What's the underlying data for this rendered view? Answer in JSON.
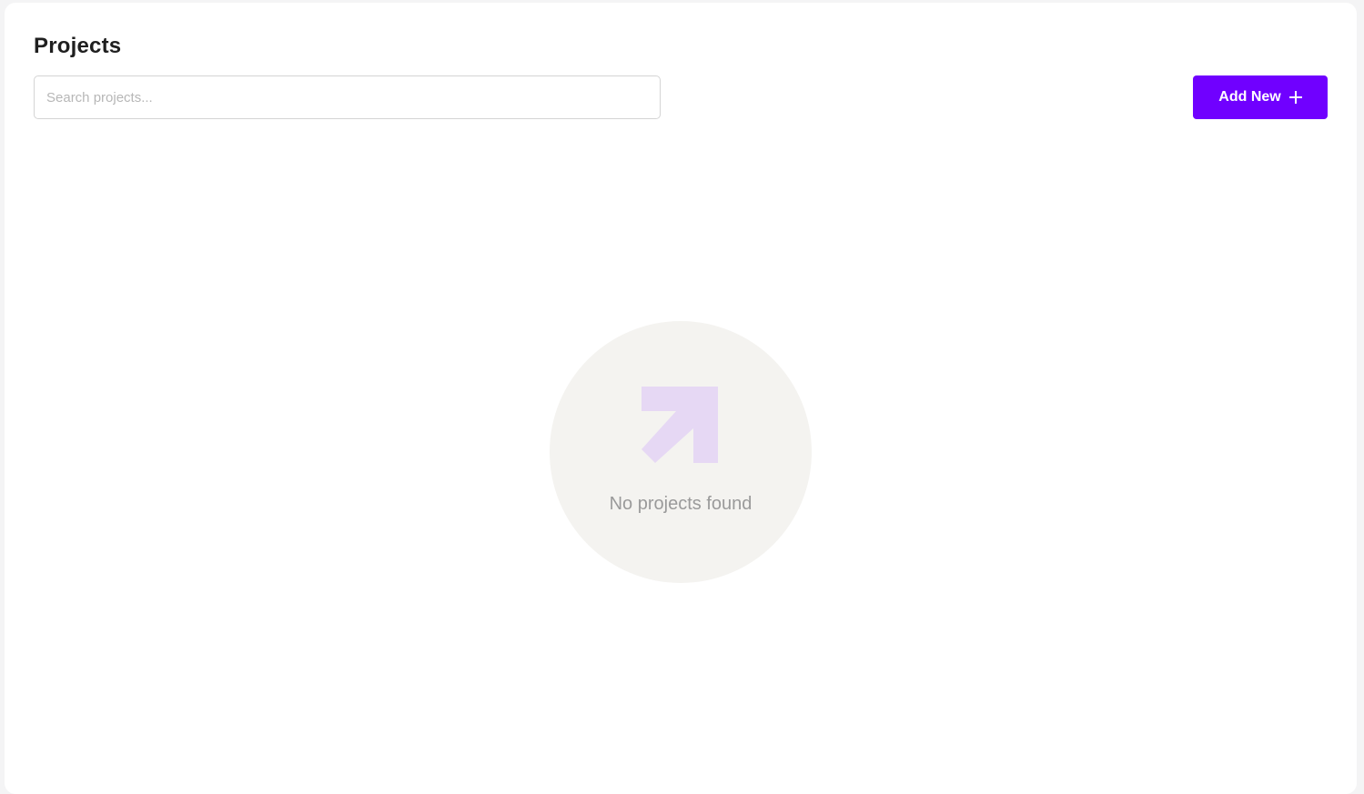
{
  "header": {
    "title": "Projects"
  },
  "search": {
    "placeholder": "Search projects...",
    "value": ""
  },
  "toolbar": {
    "add_label": "Add New",
    "add_icon": "plus-icon"
  },
  "empty_state": {
    "icon": "arrow-up-right-icon",
    "message": "No projects found"
  },
  "colors": {
    "accent": "#7000ff",
    "empty_icon": "#e6d8f4",
    "empty_circle": "#f4f3f0"
  }
}
